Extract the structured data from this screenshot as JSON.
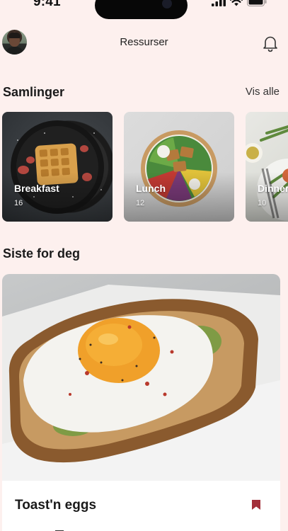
{
  "status_bar": {
    "time": "9:41"
  },
  "header": {
    "title": "Ressurser"
  },
  "collections": {
    "title": "Samlinger",
    "see_all": "Vis alle",
    "items": [
      {
        "name": "Breakfast",
        "count": "16"
      },
      {
        "name": "Lunch",
        "count": "12"
      },
      {
        "name": "Dinner",
        "count": "10"
      }
    ]
  },
  "recent": {
    "title": "Siste for deg",
    "recipe": {
      "title": "Toast'n eggs"
    }
  },
  "colors": {
    "background": "#fdf0ee",
    "bookmark": "#a3303a",
    "card": "#ffffff"
  },
  "icons": [
    "avatar",
    "bell-icon",
    "bookmark-icon",
    "signal-icon",
    "wifi-icon",
    "battery-icon"
  ]
}
